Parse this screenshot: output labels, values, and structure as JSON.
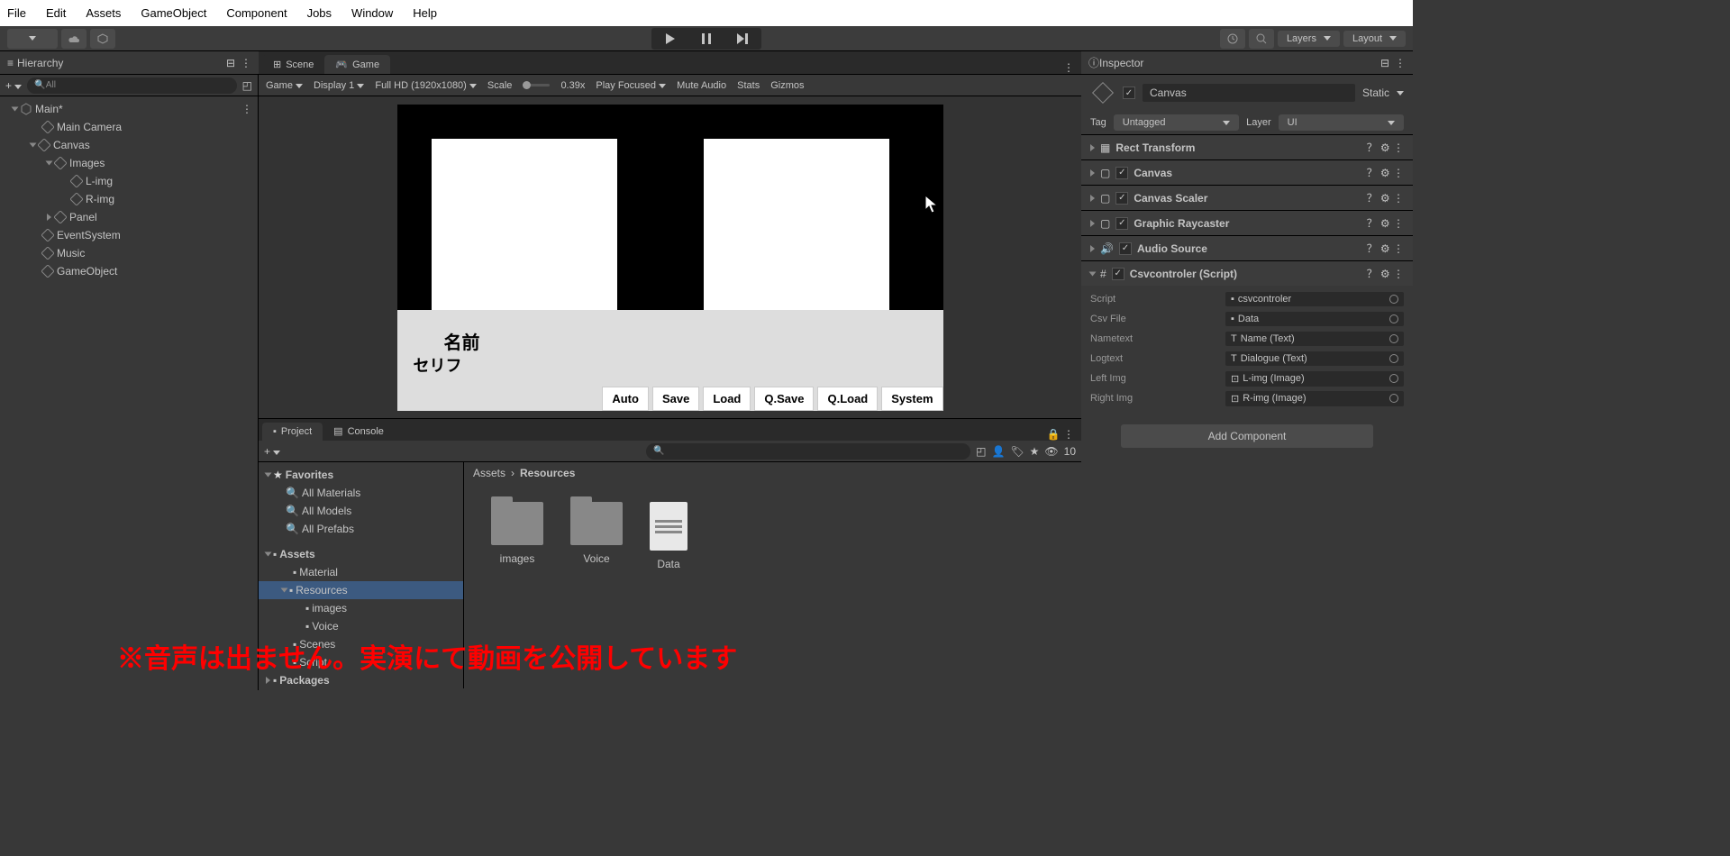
{
  "menubar": [
    "File",
    "Edit",
    "Assets",
    "GameObject",
    "Component",
    "Jobs",
    "Window",
    "Help"
  ],
  "toolbar": {
    "layers": "Layers",
    "layout": "Layout"
  },
  "hierarchy": {
    "title": "Hierarchy",
    "search": "All",
    "scene": "Main*",
    "items": [
      "Main Camera",
      "Canvas",
      "Images",
      "L-img",
      "R-img",
      "Panel",
      "EventSystem",
      "Music",
      "GameObject"
    ]
  },
  "sceneTabs": {
    "scene": "Scene",
    "game": "Game"
  },
  "sceneToolbar": {
    "mode": "Game",
    "display": "Display 1",
    "resolution": "Full HD (1920x1080)",
    "scaleLabel": "Scale",
    "scaleVal": "0.39x",
    "playMode": "Play Focused",
    "mute": "Mute Audio",
    "stats": "Stats",
    "gizmos": "Gizmos"
  },
  "gameView": {
    "name": "名前",
    "serif": "セリフ",
    "buttons": [
      "Auto",
      "Save",
      "Load",
      "Q.Save",
      "Q.Load",
      "System"
    ]
  },
  "project": {
    "tab1": "Project",
    "tab2": "Console",
    "favorites": "Favorites",
    "favItems": [
      "All Materials",
      "All Models",
      "All Prefabs"
    ],
    "assets": "Assets",
    "assetItems": [
      "Material",
      "Resources",
      "images",
      "Voice",
      "Scenes",
      "Script"
    ],
    "packages": "Packages",
    "breadcrumb1": "Assets",
    "breadcrumb2": "Resources",
    "folders": [
      "images",
      "Voice",
      "Data"
    ],
    "count": "10"
  },
  "inspector": {
    "title": "Inspector",
    "objName": "Canvas",
    "static": "Static",
    "tagLabel": "Tag",
    "tagVal": "Untagged",
    "layerLabel": "Layer",
    "layerVal": "UI",
    "components": [
      {
        "name": "Rect Transform",
        "checked": false
      },
      {
        "name": "Canvas",
        "checked": true
      },
      {
        "name": "Canvas Scaler",
        "checked": true
      },
      {
        "name": "Graphic Raycaster",
        "checked": true
      },
      {
        "name": "Audio Source",
        "checked": true
      },
      {
        "name": "Csvcontroler (Script)",
        "checked": true
      }
    ],
    "scriptProps": [
      {
        "label": "Script",
        "val": "csvcontroler"
      },
      {
        "label": "Csv File",
        "val": "Data"
      },
      {
        "label": "Nametext",
        "val": "Name (Text)"
      },
      {
        "label": "Logtext",
        "val": "Dialogue (Text)"
      },
      {
        "label": "Left Img",
        "val": "L-img (Image)"
      },
      {
        "label": "Right Img",
        "val": "R-img (Image)"
      }
    ],
    "addComponent": "Add Component"
  },
  "overlay": "※音声は出ません。実演にて動画を公開しています"
}
